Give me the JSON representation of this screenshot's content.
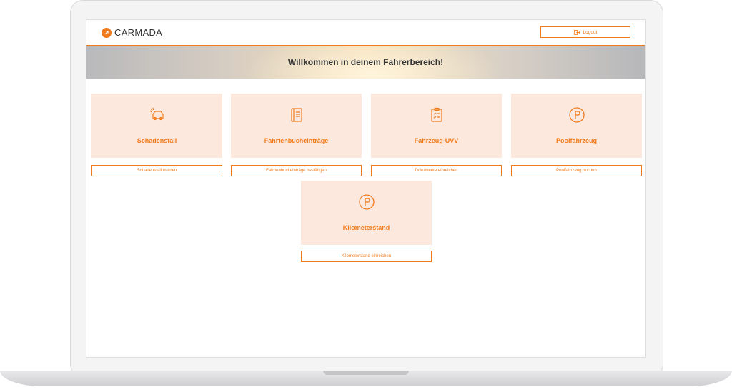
{
  "app": {
    "logo_text": "CARMADA",
    "logout_label": "Logout"
  },
  "banner": {
    "title": "Willkommen in deinem Fahrerbereich!"
  },
  "colors": {
    "accent": "#f07b1c",
    "card_bg": "#fde8dd"
  },
  "cards": [
    {
      "title": "Schadensfall",
      "button": "Schadensfall melden",
      "icon": "damage-car-icon"
    },
    {
      "title": "Fahrtenbucheinträge",
      "button": "Fahrtenbucheinträge bestätigen",
      "icon": "logbook-icon"
    },
    {
      "title": "Fahrzeug-UVV",
      "button": "Dokumente einreichen",
      "icon": "checklist-icon"
    },
    {
      "title": "Poolfahrzeug",
      "button": "Poolfahrzeug buchen",
      "icon": "parking-icon"
    },
    {
      "title": "Kilometerstand",
      "button": "Kilometerstand einreichen",
      "icon": "parking-icon"
    }
  ]
}
